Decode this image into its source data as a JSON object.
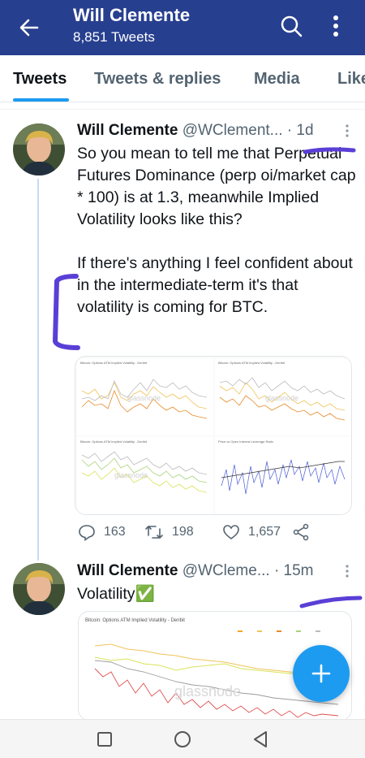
{
  "header": {
    "name": "Will Clemente",
    "tweet_count": "8,851 Tweets",
    "bg_color": "#273f8f",
    "icons": [
      "back-arrow-icon",
      "search-icon",
      "more-vertical-icon"
    ]
  },
  "tabs": [
    {
      "label": "Tweets",
      "active": true
    },
    {
      "label": "Tweets & replies",
      "active": false
    },
    {
      "label": "Media",
      "active": false
    },
    {
      "label": "Likes",
      "active": false
    }
  ],
  "tweet1": {
    "name": "Will Clemente",
    "handle": "@WClement... · 1d",
    "paragraph1": "So you mean to tell me that Perpetual Futures Dominance (perp oi/market cap * 100) is at 1.3, meanwhile Implied Volatility looks like this?",
    "paragraph2": "If there's anything I feel confident about in the intermediate-term it's that volatility is coming for BTC.",
    "media": {
      "chart1_title": "Bitcoin: Options ATM Implied Volatility - Deribit",
      "chart2_title": "Bitcoin: Options ATM Implied Volatility - Deribit",
      "chart3_title": "Bitcoin: Options ATM Implied Volatility - Deribit",
      "chart4_title": "Price vs Open Interest Leverage Ratio",
      "watermark": "glassnode"
    },
    "replies": "163",
    "retweets": "198",
    "likes": "1,657"
  },
  "tweet2": {
    "name": "Will Clemente",
    "handle": "@WCleme... · 15m",
    "text": "Volatility✅",
    "media": {
      "chart_title": "Bitcoin: Options ATM Implied Volatility - Deribit",
      "watermark": "glassnode"
    }
  },
  "colors": {
    "accent": "#1d9bf0",
    "annotation": "#5a3fd6"
  }
}
